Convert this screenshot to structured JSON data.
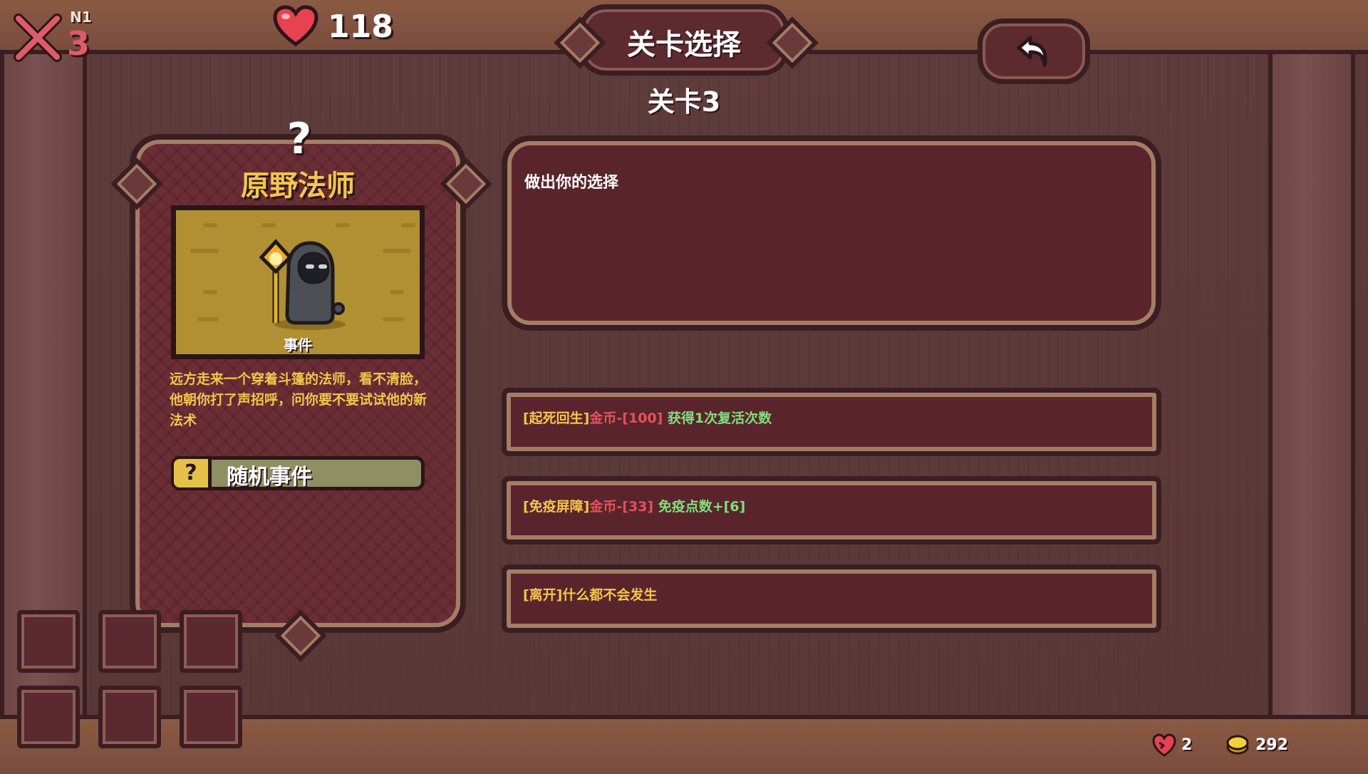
{
  "hud": {
    "floor_tag": "N1",
    "level": "3",
    "hp": "118"
  },
  "header": {
    "title": "关卡选择",
    "subtitle": "关卡3"
  },
  "card": {
    "title": "原野法师",
    "art_label": "事件",
    "description": "远方走来一个穿着斗篷的法师，看不清脸，他朝你打了声招呼，问你要不要试试他的新法术",
    "tag_label": "随机事件",
    "tag_icon": "?"
  },
  "dialog": {
    "prompt": "做出你的选择"
  },
  "options": [
    {
      "name": "[起死回生]",
      "cost": "金币-[100]",
      "effect": " 获得1次复活次数"
    },
    {
      "name": "[免疫屏障]",
      "cost": "金币-[33]",
      "effect": " 免疫点数+[6]"
    },
    {
      "name": "[离开]什么都不会发生",
      "cost": "",
      "effect": ""
    }
  ],
  "resources": {
    "revive_count": "2",
    "gold": "292"
  },
  "colors": {
    "gold_text": "#f3c64c",
    "cost_red": "#e2525a",
    "effect_green": "#7fe07a",
    "panel": "#5a242c"
  }
}
